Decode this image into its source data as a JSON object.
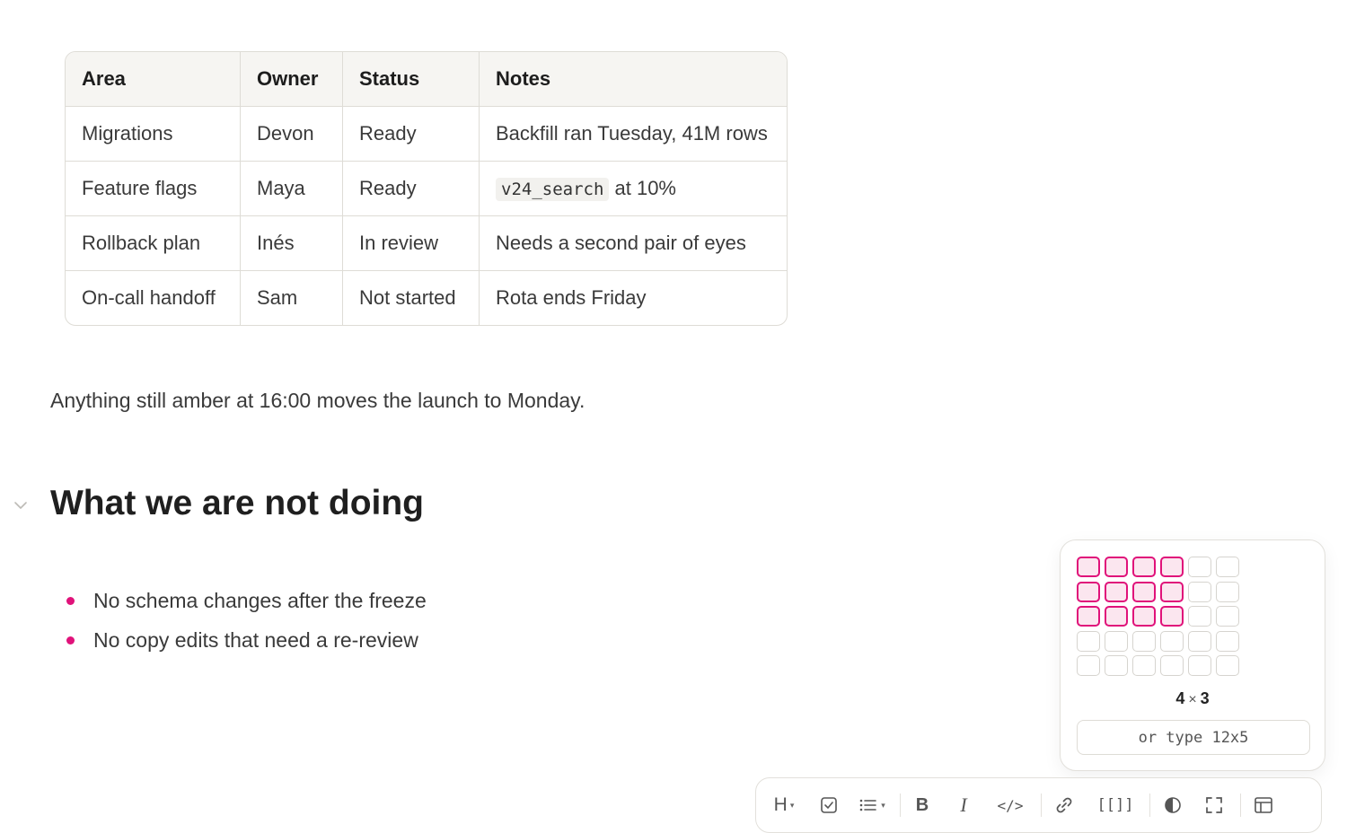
{
  "table": {
    "headers": [
      "Area",
      "Owner",
      "Status",
      "Notes"
    ],
    "rows": [
      {
        "area": "Migrations",
        "owner": "Devon",
        "status": "Ready",
        "notes": "Backfill ran Tuesday, 41M rows",
        "notes_code": ""
      },
      {
        "area": "Feature flags",
        "owner": "Maya",
        "status": "Ready",
        "notes": " at 10%",
        "notes_code": "v24_search"
      },
      {
        "area": "Rollback plan",
        "owner": "Inés",
        "status": "In review",
        "notes": "Needs a second pair of eyes",
        "notes_code": ""
      },
      {
        "area": "On-call handoff",
        "owner": "Sam",
        "status": "Not started",
        "notes": "Rota ends Friday",
        "notes_code": ""
      }
    ]
  },
  "paragraph": "Anything still amber at 16:00 moves the launch to Monday.",
  "section": {
    "heading": "What we are not doing",
    "bullets": [
      "No schema changes after the freeze",
      "No copy edits that need a re-review"
    ]
  },
  "table_picker": {
    "grid_columns": 6,
    "grid_rows": 5,
    "selected_columns": 4,
    "selected_rows": 3,
    "cols_label": "4",
    "times_sign": "×",
    "rows_label": "3",
    "input_placeholder": "or type 12x5"
  },
  "toolbar": {
    "heading_label": "H",
    "bold_label": "B",
    "italic_label": "I",
    "code_label": "</>",
    "wikilink_label": "[[]]",
    "buttons": [
      "heading",
      "checkbox",
      "bullet-list",
      "bold",
      "italic",
      "code",
      "link",
      "wikilink",
      "theme",
      "fullscreen",
      "table"
    ]
  },
  "colors": {
    "accent": "#e0127a",
    "accent_fill": "#fbe6ef",
    "border": "#dedcd6",
    "header_bg": "#f6f5f2"
  }
}
